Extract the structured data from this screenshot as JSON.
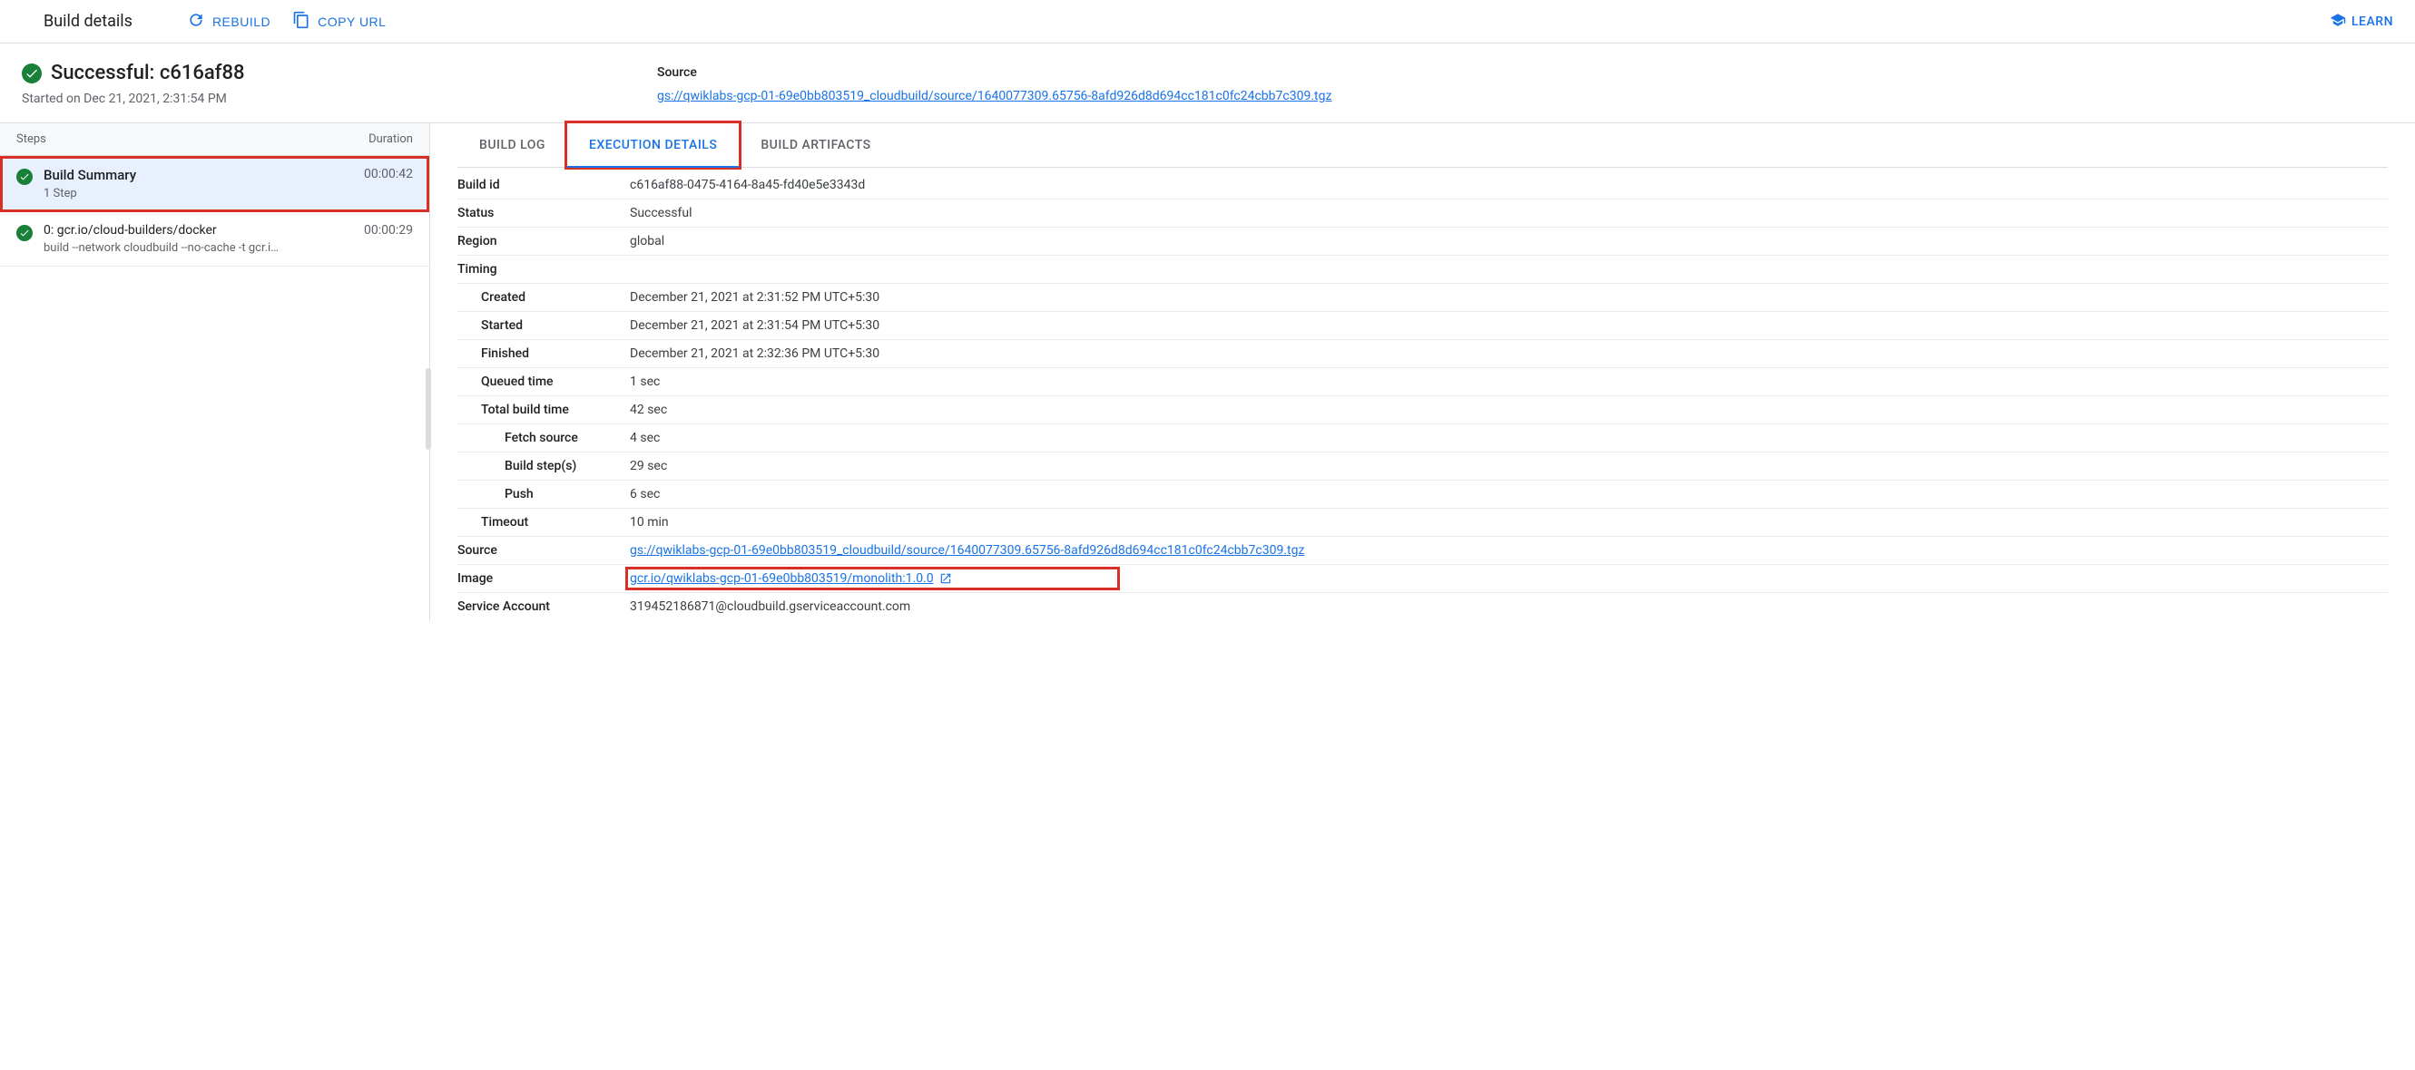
{
  "header": {
    "title": "Build details",
    "rebuild_label": "REBUILD",
    "copy_url_label": "COPY URL",
    "learn_label": "LEARN"
  },
  "summary": {
    "status_title": "Successful: c616af88",
    "started_text": "Started on Dec 21, 2021, 2:31:54 PM",
    "source_label": "Source",
    "source_link": "gs://qwiklabs-gcp-01-69e0bb803519_cloudbuild/source/1640077309.65756-8afd926d8d694cc181c0fc24cbb7c309.tgz"
  },
  "steps_panel": {
    "header_steps": "Steps",
    "header_duration": "Duration",
    "items": [
      {
        "title": "Build Summary",
        "subtitle": "1 Step",
        "duration": "00:00:42"
      },
      {
        "title": "0: gcr.io/cloud-builders/docker",
        "subtitle": "build --network cloudbuild --no-cache -t gcr.i…",
        "duration": "00:00:29"
      }
    ]
  },
  "tabs": {
    "build_log": "BUILD LOG",
    "execution_details": "EXECUTION DETAILS",
    "build_artifacts": "BUILD ARTIFACTS"
  },
  "details": {
    "build_id_label": "Build id",
    "build_id": "c616af88-0475-4164-8a45-fd40e5e3343d",
    "status_label": "Status",
    "status": "Successful",
    "region_label": "Region",
    "region": "global",
    "timing_label": "Timing",
    "created_label": "Created",
    "created": "December 21, 2021 at 2:31:52 PM UTC+5:30",
    "started_label": "Started",
    "started": "December 21, 2021 at 2:31:54 PM UTC+5:30",
    "finished_label": "Finished",
    "finished": "December 21, 2021 at 2:32:36 PM UTC+5:30",
    "queued_label": "Queued time",
    "queued": "1 sec",
    "total_label": "Total build time",
    "total": "42 sec",
    "fetch_label": "Fetch source",
    "fetch": "4 sec",
    "steps_label": "Build step(s)",
    "steps_time": "29 sec",
    "push_label": "Push",
    "push": "6 sec",
    "timeout_label": "Timeout",
    "timeout": "10 min",
    "source_label": "Source",
    "source": "gs://qwiklabs-gcp-01-69e0bb803519_cloudbuild/source/1640077309.65756-8afd926d8d694cc181c0fc24cbb7c309.tgz",
    "image_label": "Image",
    "image": "gcr.io/qwiklabs-gcp-01-69e0bb803519/monolith:1.0.0",
    "service_account_label": "Service Account",
    "service_account": "319452186871@cloudbuild.gserviceaccount.com"
  }
}
